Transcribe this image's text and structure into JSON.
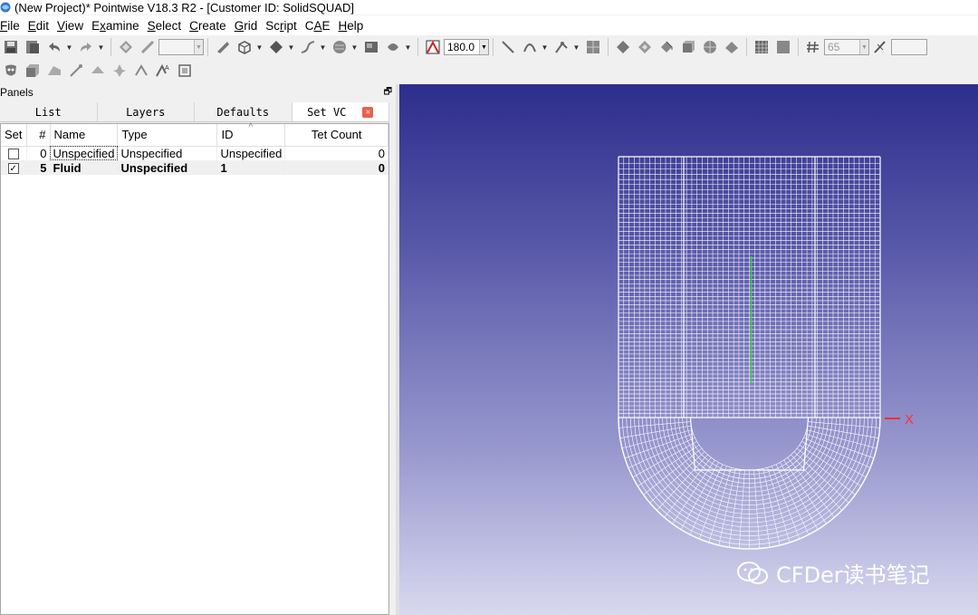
{
  "window": {
    "title": "(New Project)* Pointwise V18.3 R2 - [Customer ID: SolidSQUAD]"
  },
  "menu": [
    {
      "label": "File",
      "key": "F",
      "rest": "ile"
    },
    {
      "label": "Edit",
      "key": "E",
      "rest": "dit"
    },
    {
      "label": "View",
      "key": "V",
      "rest": "iew"
    },
    {
      "label": "Examine",
      "key": "x",
      "pre": "E",
      "rest": "amine"
    },
    {
      "label": "Select",
      "key": "S",
      "rest": "elect"
    },
    {
      "label": "Create",
      "key": "C",
      "rest": "reate"
    },
    {
      "label": "Grid",
      "key": "G",
      "rest": "rid"
    },
    {
      "label": "Script",
      "key": "r",
      "pre": "Sc",
      "rest": "ipt"
    },
    {
      "label": "CAE",
      "key": "A",
      "pre": "C",
      "rest": "E"
    },
    {
      "label": "Help",
      "key": "H",
      "rest": "elp"
    }
  ],
  "toolbar": {
    "angle_value": "180.0",
    "count_value": "65"
  },
  "panel": {
    "title": "Panels",
    "tabs": [
      "List",
      "Layers",
      "Defaults",
      "Set VC"
    ],
    "active_tab": 3,
    "columns": [
      "Set",
      "#",
      "Name",
      "Type",
      "ID",
      "Tet Count"
    ],
    "rows": [
      {
        "set": false,
        "num": "0",
        "name": "Unspecified",
        "type": "Unspecified",
        "id": "Unspecified",
        "tet": "0",
        "bold": false
      },
      {
        "set": true,
        "num": "5",
        "name": "Fluid",
        "type": "Unspecified",
        "id": "1",
        "tet": "0",
        "bold": true
      }
    ]
  },
  "viewport": {
    "axis_label": "X",
    "watermark": "CFDer读书笔记"
  },
  "colors": {
    "mesh": "#ffffff",
    "axis": "#ff3030",
    "highlight": "#30e030"
  }
}
